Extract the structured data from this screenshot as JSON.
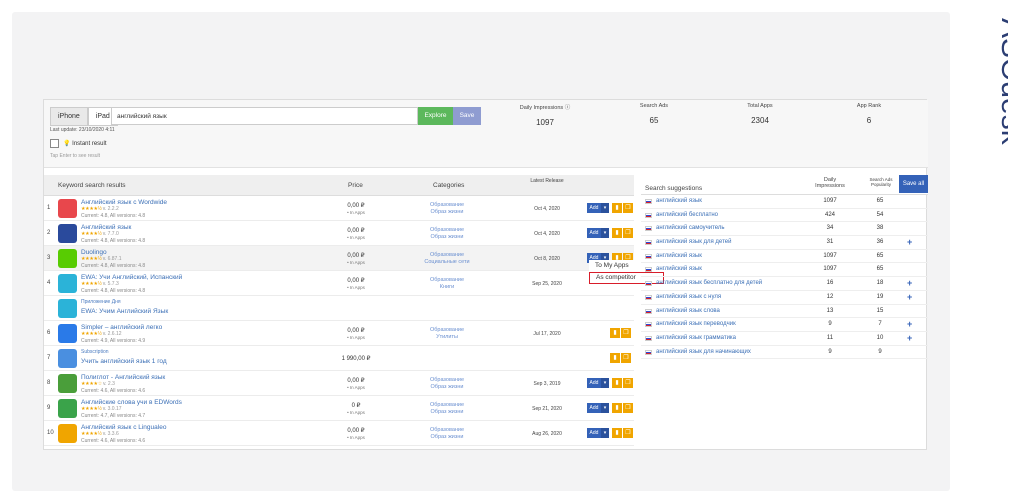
{
  "brand": {
    "logo_text": "ASOdesk"
  },
  "toolbar": {
    "tabs": [
      "iPhone",
      "iPad"
    ],
    "search_value": "английский язык",
    "explore_label": "Explore",
    "save_label": "Save",
    "last_update": "Last update: 23/10/2020 4:11",
    "instant_label": "Instant result",
    "tap_hint": "Tap Enter to see result"
  },
  "stats": [
    {
      "label": "Daily Impressions",
      "value": "1097",
      "has_info": true
    },
    {
      "label": "Search Ads",
      "value": "65"
    },
    {
      "label": "Total Apps",
      "value": "2304"
    },
    {
      "label": "App Rank",
      "value": "6"
    }
  ],
  "keyword_table": {
    "title": "Keyword search results",
    "col_price": "Price",
    "col_categories": "Categories",
    "col_release": "Latest Release",
    "add_label": "Add",
    "rows": [
      {
        "n": "1",
        "title": "Английский язык с Wordwide",
        "stars": "★★★★½",
        "version": "v. 2.2.2",
        "current": "Current: 4.8, All versions: 4.8",
        "price": "0,00 ₽",
        "inapps": "• In Apps",
        "cat1": "Образование",
        "cat2": "Образ жизни",
        "release": "Oct 4, 2020",
        "icon": "#e8474c",
        "actions": "full"
      },
      {
        "n": "2",
        "title": "Английский язык",
        "stars": "★★★★½",
        "version": "v. 7.7.0",
        "current": "Current: 4.8, All versions: 4.8",
        "price": "0,00 ₽",
        "inapps": "• In Apps",
        "cat1": "Образование",
        "cat2": "Образ жизни",
        "release": "Oct 4, 2020",
        "icon": "#2a4a9c",
        "actions": "full"
      },
      {
        "n": "3",
        "title": "Duolingo",
        "stars": "★★★★½",
        "version": "v. 6.87.1",
        "current": "Current: 4.8, All versions: 4.8",
        "price": "0,00 ₽",
        "inapps": "• In Apps",
        "cat1": "Образование",
        "cat2": "Социальные сети",
        "release": "Oct 8, 2020",
        "icon": "#58cc02",
        "actions": "full",
        "highlight": true
      },
      {
        "n": "4",
        "title": "EWA: Учи Английский, Испанский",
        "stars": "★★★★½",
        "version": "v. 5.7.3",
        "current": "Current: 4.8, All versions: 4.8",
        "price": "0,00 ₽",
        "inapps": "• In Apps",
        "cat1": "Образование",
        "cat2": "Книги",
        "release": "Sep 25, 2020",
        "icon": "#2bb3d8",
        "actions": "none"
      },
      {
        "n": "",
        "subtitle": "Приложение Дня",
        "title": "EWA: Учим Английский Язык",
        "icon": "#2bb3d8",
        "actions": "none",
        "kind": "story"
      },
      {
        "n": "6",
        "title": "Simpler – английский легко",
        "stars": "★★★★½",
        "version": "v. 2.6.12",
        "current": "Current: 4.9, All versions: 4.9",
        "price": "0,00 ₽",
        "inapps": "• In Apps",
        "cat1": "Образование",
        "cat2": "Утилиты",
        "release": "Jul 17, 2020",
        "icon": "#2a7ae8",
        "actions": "small"
      },
      {
        "n": "7",
        "subtitle": "Subscription",
        "title": "Учить английский язык 1 год",
        "price": "1 990,00 ₽",
        "icon": "#4a8fe0",
        "actions": "small",
        "kind": "sub"
      },
      {
        "n": "8",
        "title": "Полиглот - Английский язык",
        "stars": "★★★★☆",
        "version": "v. 2.3",
        "current": "Current: 4.6, All versions: 4.6",
        "price": "0,00 ₽",
        "inapps": "• In Apps",
        "cat1": "Образование",
        "cat2": "Образ жизни",
        "release": "Sep 3, 2019",
        "icon": "#4a9e3a",
        "actions": "full"
      },
      {
        "n": "9",
        "title": "Английские слова учи в EDWords",
        "stars": "★★★★½",
        "version": "v. 3.0.17",
        "current": "Current: 4.7, All versions: 4.7",
        "price": "0 ₽",
        "inapps": "• In Apps",
        "cat1": "Образование",
        "cat2": "Образ жизни",
        "release": "Sep 21, 2020",
        "icon": "#3aa34a",
        "actions": "full"
      },
      {
        "n": "10",
        "title": "Английский язык с Lingualeo",
        "stars": "★★★★½",
        "version": "v. 3.3.6",
        "current": "Current: 4.6, All versions: 4.6",
        "price": "0,00 ₽",
        "inapps": "• In Apps",
        "cat1": "Образование",
        "cat2": "Образ жизни",
        "release": "Aug 26, 2020",
        "icon": "#f0a500",
        "actions": "full"
      }
    ]
  },
  "dropdown": {
    "items": [
      "To My Apps",
      "As competitor"
    ]
  },
  "suggestions": {
    "title": "Search suggestions",
    "col_impressions": "Daily Impressions",
    "col_popularity": "Search Ads Popularity",
    "save_all_label": "Save all",
    "rows": [
      {
        "kw": "английский язык",
        "imp": "1097",
        "pop": "65",
        "plus": false
      },
      {
        "kw": "английский бесплатно",
        "imp": "424",
        "pop": "54",
        "plus": false
      },
      {
        "kw": "английский самоучитель",
        "imp": "34",
        "pop": "38",
        "plus": false
      },
      {
        "kw": "английский язык для детей",
        "imp": "31",
        "pop": "36",
        "plus": true
      },
      {
        "kw": "английский язык",
        "imp": "1097",
        "pop": "65",
        "plus": false
      },
      {
        "kw": "английский язык",
        "imp": "1097",
        "pop": "65",
        "plus": false
      },
      {
        "kw": "английский язык бесплатно для детей",
        "imp": "16",
        "pop": "18",
        "plus": true
      },
      {
        "kw": "английский язык с нуля",
        "imp": "12",
        "pop": "19",
        "plus": true
      },
      {
        "kw": "английский язык слова",
        "imp": "13",
        "pop": "15",
        "plus": false
      },
      {
        "kw": "английский язык переводчик",
        "imp": "9",
        "pop": "7",
        "plus": true
      },
      {
        "kw": "английский язык грамматика",
        "imp": "11",
        "pop": "10",
        "plus": true
      },
      {
        "kw": "английский язык для начинающих",
        "imp": "9",
        "pop": "9",
        "plus": false
      }
    ]
  }
}
